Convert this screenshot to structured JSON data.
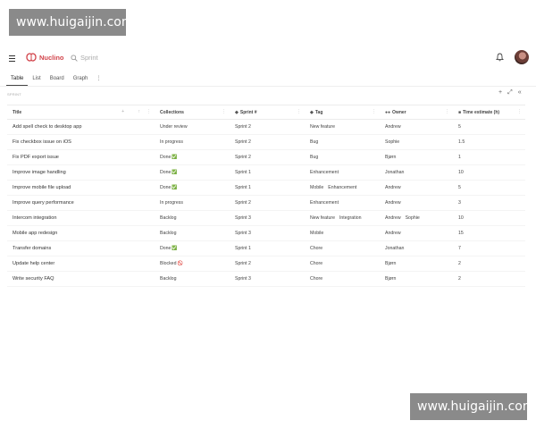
{
  "watermark": {
    "text": "www.huigaijin.com"
  },
  "header": {
    "logo": "Nuclino",
    "search_placeholder": "Sprint",
    "brand_color": "#d2444b"
  },
  "views": {
    "tabs": [
      "Table",
      "List",
      "Board",
      "Graph"
    ],
    "active": "Table",
    "more": "⋮"
  },
  "section": {
    "title": "SPRINT"
  },
  "table": {
    "headers": [
      "Title",
      "Collections",
      "Sprint #",
      "Tag",
      "Owner",
      "Time estimate (h)"
    ],
    "rows": [
      {
        "title": "Add spell check to desktop app",
        "collection": "Under review",
        "status_icon": "",
        "sprint": "Sprint 2",
        "tags": [
          "New feature"
        ],
        "owners": [
          "Andrew"
        ],
        "time": "5"
      },
      {
        "title": "Fix checkbox issue on iOS",
        "collection": "In progress",
        "status_icon": "",
        "sprint": "Sprint 2",
        "tags": [
          "Bug"
        ],
        "owners": [
          "Sophie"
        ],
        "time": "1.5"
      },
      {
        "title": "Fix PDF export issue",
        "collection": "Done",
        "status_icon": "✅",
        "sprint": "Sprint 2",
        "tags": [
          "Bug"
        ],
        "owners": [
          "Bjørn"
        ],
        "time": "1"
      },
      {
        "title": "Improve image handling",
        "collection": "Done",
        "status_icon": "✅",
        "sprint": "Sprint 1",
        "tags": [
          "Enhancement"
        ],
        "owners": [
          "Jonathan"
        ],
        "time": "10"
      },
      {
        "title": "Improve mobile file upload",
        "collection": "Done",
        "status_icon": "✅",
        "sprint": "Sprint 1",
        "tags": [
          "Mobile",
          "Enhancement"
        ],
        "owners": [
          "Andrew"
        ],
        "time": "5"
      },
      {
        "title": "Improve query performance",
        "collection": "In progress",
        "status_icon": "",
        "sprint": "Sprint 2",
        "tags": [
          "Enhancement"
        ],
        "owners": [
          "Andrew"
        ],
        "time": "3"
      },
      {
        "title": "Intercom integration",
        "collection": "Backlog",
        "status_icon": "",
        "sprint": "Sprint 3",
        "tags": [
          "New feature",
          "Integration"
        ],
        "owners": [
          "Andrew",
          "Sophie"
        ],
        "time": "10"
      },
      {
        "title": "Mobile app redesign",
        "collection": "Backlog",
        "status_icon": "",
        "sprint": "Sprint 3",
        "tags": [
          "Mobile"
        ],
        "owners": [
          "Andrew"
        ],
        "time": "15"
      },
      {
        "title": "Transfer domains",
        "collection": "Done",
        "status_icon": "✅",
        "sprint": "Sprint 1",
        "tags": [
          "Chore"
        ],
        "owners": [
          "Jonathan"
        ],
        "time": "7"
      },
      {
        "title": "Update help center",
        "collection": "Blocked",
        "status_icon": "🚫",
        "sprint": "Sprint 2",
        "tags": [
          "Chore"
        ],
        "owners": [
          "Bjørn"
        ],
        "time": "2"
      },
      {
        "title": "Write security FAQ",
        "collection": "Backlog",
        "status_icon": "",
        "sprint": "Sprint 3",
        "tags": [
          "Chore"
        ],
        "owners": [
          "Bjørn"
        ],
        "time": "2"
      }
    ]
  }
}
